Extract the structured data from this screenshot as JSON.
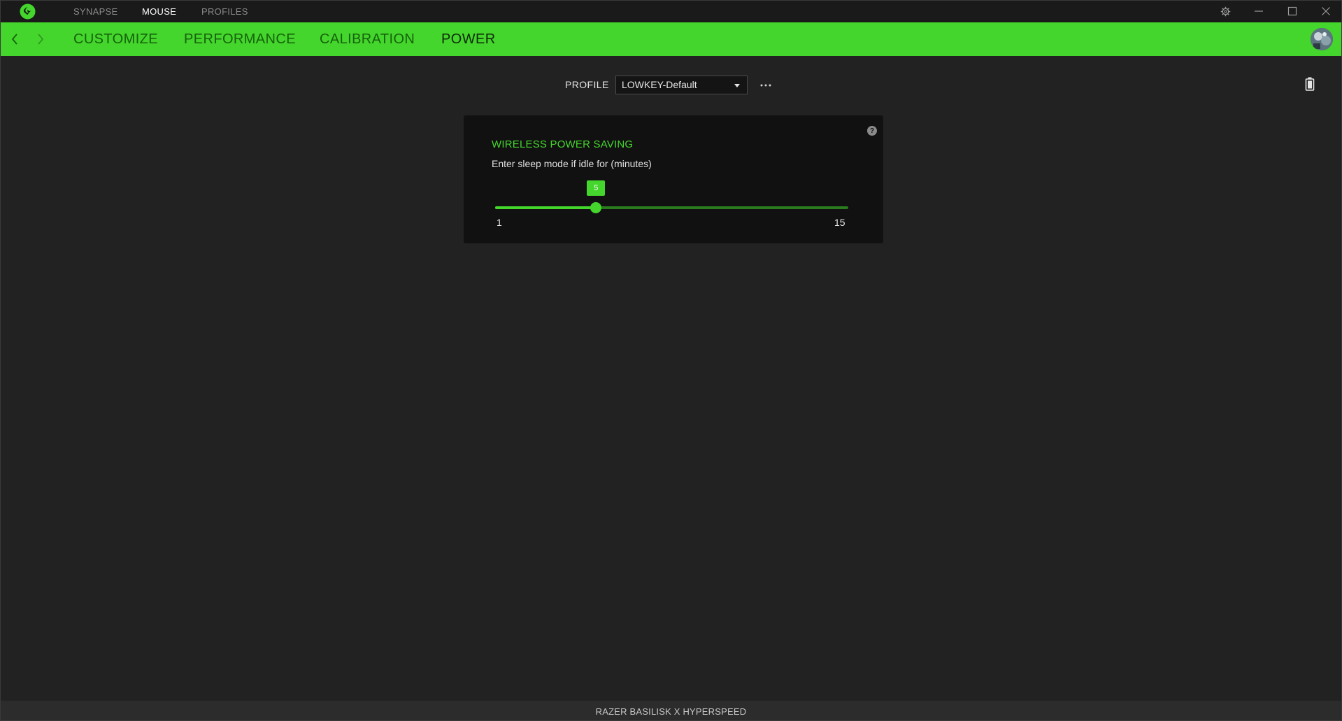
{
  "topnav": {
    "items": [
      {
        "label": "SYNAPSE",
        "active": false
      },
      {
        "label": "MOUSE",
        "active": true
      },
      {
        "label": "PROFILES",
        "active": false
      }
    ]
  },
  "icons": {
    "logo": "razer-logo-icon",
    "settings": "gear-icon",
    "minimize": "minimize-icon",
    "maximize": "maximize-icon",
    "close": "close-icon",
    "back": "chevron-left-icon",
    "forward": "chevron-right-icon",
    "more": "ellipsis-icon",
    "battery": "battery-icon",
    "help": "help-icon"
  },
  "subnav": {
    "tabs": [
      {
        "label": "CUSTOMIZE",
        "active": false
      },
      {
        "label": "PERFORMANCE",
        "active": false
      },
      {
        "label": "CALIBRATION",
        "active": false
      },
      {
        "label": "POWER",
        "active": true
      }
    ]
  },
  "profile": {
    "label": "PROFILE",
    "selected": "LOWKEY-Default"
  },
  "power_card": {
    "title": "WIRELESS POWER SAVING",
    "description": "Enter sleep mode if idle for (minutes)",
    "help_symbol": "?",
    "slider": {
      "value": 5,
      "min": 1,
      "max": 15,
      "value_label": "5",
      "min_label": "1",
      "max_label": "15"
    }
  },
  "footer": {
    "device_name": "RAZER BASILISK X HYPERSPEED"
  },
  "colors": {
    "accent": "#44d62c",
    "background": "#222222",
    "card": "#111111",
    "titlebar": "#1a1a1a"
  }
}
